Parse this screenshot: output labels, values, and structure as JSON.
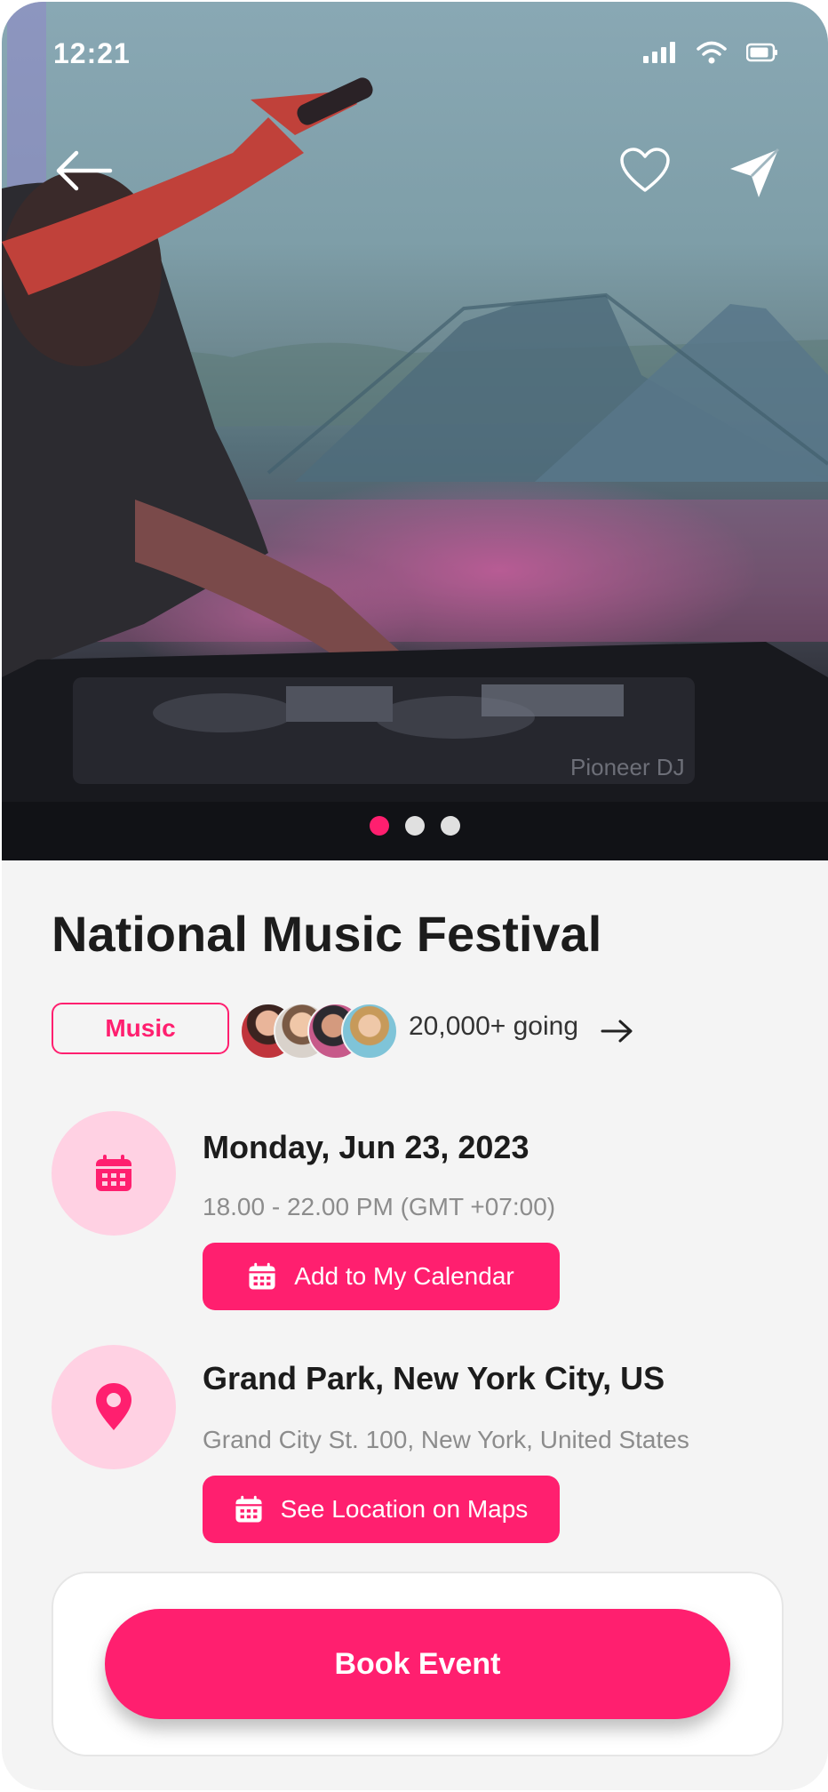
{
  "status_bar": {
    "time": "12:21"
  },
  "hero": {
    "icons": {
      "back": "arrow-left-icon",
      "favorite": "heart-icon",
      "share": "send-icon"
    },
    "carousel": {
      "count": 3,
      "active_index": 0
    },
    "photo_caption": "Pioneer DJ"
  },
  "event": {
    "title": "National Music Festival",
    "category": "Music",
    "attendees": "20,000+ going"
  },
  "date_section": {
    "date": "Monday, Jun 23, 2023",
    "time": "18.00 - 22.00 PM (GMT +07:00)",
    "button_label": "Add to My Calendar"
  },
  "location_section": {
    "venue": "Grand Park, New York City, US",
    "address": "Grand City St. 100, New York, United States",
    "button_label": "See Location on Maps"
  },
  "cta": {
    "label": "Book Event"
  },
  "colors": {
    "accent": "#ff1f6f",
    "accent_light": "#ffd1e3",
    "background": "#f4f4f4"
  }
}
